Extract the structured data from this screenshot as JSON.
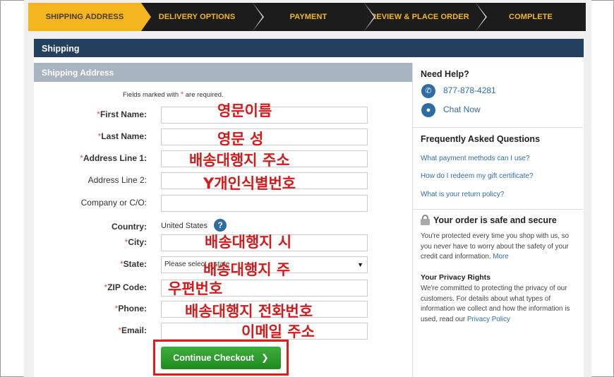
{
  "steps": [
    {
      "label": "SHIPPING ADDRESS",
      "active": true
    },
    {
      "label": "DELIVERY OPTIONS",
      "active": false
    },
    {
      "label": "PAYMENT",
      "active": false
    },
    {
      "label": "REVIEW & PLACE ORDER",
      "active": false
    },
    {
      "label": "COMPLETE",
      "active": false
    }
  ],
  "section_title": "Shipping",
  "form_title": "Shipping Address",
  "required_note": {
    "before": "Fields marked with",
    "star": "*",
    "after": "are required."
  },
  "fields": {
    "first_name": {
      "label": "First Name:",
      "annotation": "영문이름"
    },
    "last_name": {
      "label": "Last Name:",
      "annotation": "영문 성"
    },
    "address1": {
      "label": "Address Line 1:",
      "annotation": "배송대행지 주소"
    },
    "address2": {
      "label": "Address Line 2:",
      "annotation": "Y개인식별번호"
    },
    "company": {
      "label": "Company or C/O:"
    },
    "country": {
      "label": "Country:",
      "value": "United States",
      "help": "?"
    },
    "city": {
      "label": "City:",
      "annotation": "배송대행지 시"
    },
    "state": {
      "label": "State:",
      "value": "Please select a state",
      "annotation": "배송대행지 주"
    },
    "zip": {
      "label": "ZIP Code:",
      "annotation": "우편번호"
    },
    "phone": {
      "label": "Phone:",
      "annotation": "배송대행지 전화번호"
    },
    "email": {
      "label": "Email:",
      "annotation": "이메일 주소"
    }
  },
  "star": "*",
  "continue_button": "Continue Checkout",
  "sidebar": {
    "need_help": "Need Help?",
    "phone": "877-878-4281",
    "chat": "Chat Now",
    "faq_title": "Frequently Asked Questions",
    "faq": [
      "What payment methods can I use?",
      "How do I redeem my gift certificate?",
      "What is your return policy?"
    ],
    "safe_title": "Your order is safe and secure",
    "safe_text": "You're protected every time you shop with us, so you never have to worry about the safety of your credit card information.",
    "safe_more": "More",
    "privacy_title": "Your Privacy Rights",
    "privacy_text": "We're committed to protecting the privacy of our customers. For details about what types of information we collect and how the information is used, read our",
    "privacy_link": "Privacy Policy"
  },
  "colors": {
    "accent": "#f3b620",
    "header": "#23405f",
    "link": "#2e6da4",
    "required": "#d9534f",
    "annotation": "#d41a1a",
    "button": "#2a9a2a"
  }
}
